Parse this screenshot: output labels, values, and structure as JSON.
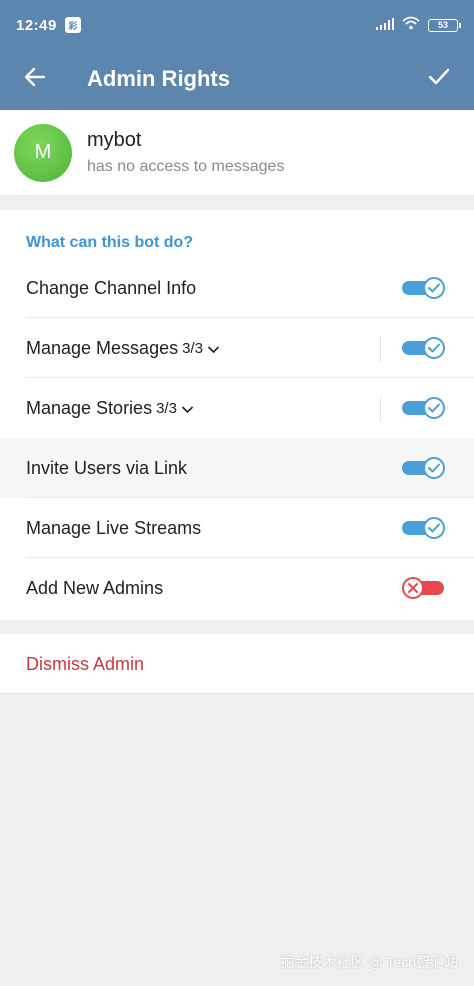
{
  "status_bar": {
    "time": "12:49",
    "app_icon_text": "彩",
    "battery": "53"
  },
  "toolbar": {
    "title": "Admin Rights"
  },
  "bot": {
    "avatar_letter": "M",
    "name": "mybot",
    "status": "has no access to messages"
  },
  "rights": {
    "section_title": "What can this bot do?",
    "items": [
      {
        "label": "Change Channel Info",
        "count": "",
        "enabled": true
      },
      {
        "label": "Manage Messages",
        "count": "3/3",
        "enabled": true
      },
      {
        "label": "Manage Stories",
        "count": "3/3",
        "enabled": true
      },
      {
        "label": "Invite Users via Link",
        "count": "",
        "enabled": true
      },
      {
        "label": "Manage Live Streams",
        "count": "",
        "enabled": true
      },
      {
        "label": "Add New Admins",
        "count": "",
        "enabled": false
      }
    ]
  },
  "dismiss": {
    "label": "Dismiss Admin"
  },
  "watermark": "掘金技术社区 @ Tech智汇站",
  "colors": {
    "header": "#5c86ad",
    "accent": "#3e95cf",
    "toggle_on": "#4a9fd9",
    "toggle_off": "#e5484d",
    "danger": "#c8393e"
  }
}
